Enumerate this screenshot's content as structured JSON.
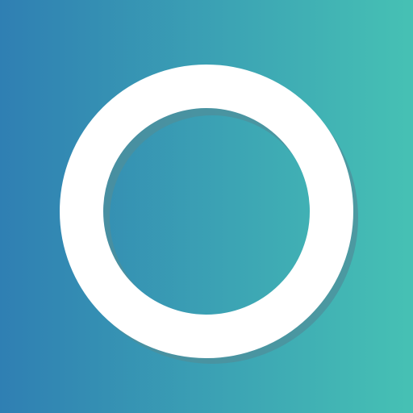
{
  "colors": {
    "gradient_start": "#2f7fb3",
    "gradient_end": "#46c1b4",
    "ring": "#ffffff",
    "ring_shadow": "#4f8f9b"
  },
  "icon": {
    "name": "ring-icon"
  }
}
